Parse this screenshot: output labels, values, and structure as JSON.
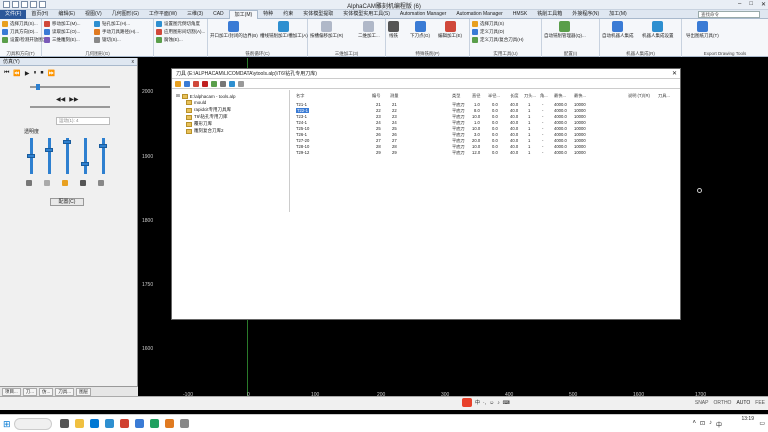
{
  "app": {
    "title": "AlphaCAM雕刻机编程版 (6)",
    "search_placeholder": "查找命令"
  },
  "tabs": [
    "文件(F)",
    "首页(H)",
    "编辑(E)",
    "视图(V)",
    "几何图形(G)",
    "工作平面(W)",
    "三维(3)",
    "CAD",
    "加工(M)",
    "特种",
    "约束",
    "实体模型提取",
    "实体模型实用工具(S)",
    "Automation Manager",
    "Automation Manager",
    "HMSK",
    "铣削工具箱",
    "外接程序(N)",
    "加工(M)"
  ],
  "ribbon": {
    "group1": {
      "label": "刀具和方向(T)",
      "items": [
        "选择刀具(S)...",
        "刀具方向(D)...",
        "设置/检测开放图元"
      ]
    },
    "group2": {
      "label": "几何图形(G)",
      "items": [
        "移动加工(M)...",
        "读取加工(O)...",
        "三维雕刻(E)...",
        "钻孔加工(H)...",
        "手动刀具路径(H)...",
        "锯切(S)..."
      ]
    },
    "group3": {
      "items": [
        "设置图元倒切角度",
        "应用图形间切割(A)...",
        "腐蚀(E)..."
      ]
    },
    "group4": {
      "label": "铣削循环(C)",
      "items": [
        "开口加工/封闭的边界(B)",
        "槽线铣削加工/槽加工(A)"
      ]
    },
    "group5": {
      "label": "三维加工(3)",
      "items": [
        "按槽偏移加工(R)",
        "二维加工..."
      ]
    },
    "group6": {
      "label": "特殊铣削(P)",
      "items": [
        "线铣",
        "下刀点(G)",
        "编辑加工(E)"
      ]
    },
    "group7": {
      "label": "实用工具(U)",
      "items": [
        "选择刀具(S)",
        "定义刀具(D)",
        "定义刀具/复合刀具(H)"
      ]
    },
    "group8": {
      "label": "配置(I)",
      "items": [
        "自动铣削管理器(Q)..."
      ]
    },
    "group9": {
      "label": "机器人集成(R)",
      "items": [
        "自动机器人集成",
        "机器人集成设置"
      ]
    },
    "group10": {
      "label": "Export Drawing Tools",
      "items": [
        "导出图纸刀具(T)"
      ]
    }
  },
  "left_panel": {
    "title": "仿真(Y)",
    "close": "x",
    "speed_label": "运动(1): 4",
    "visible_label": "透明度",
    "config_button": "配置(C)",
    "bottom_tabs": [
      "项目...",
      "刀...",
      "仿...",
      "刀具...",
      "图层"
    ]
  },
  "canvas": {
    "y_labels": [
      "2000",
      "1900",
      "1800",
      "1750",
      "1600"
    ],
    "x_labels": [
      "-100",
      "0",
      "100",
      "200",
      "300",
      "400",
      "500",
      "1600",
      "1700"
    ]
  },
  "dialog": {
    "title": "刀具 (E:\\ALPHACAM\\LICOMDATA\\ytools.alp)\\T6\\钻孔专用刀库)",
    "tree": {
      "root": "E:\\alphacam - tools.alp",
      "items": [
        "mould",
        "rapidcit专用刀具库",
        "T6\\钻孔专用刀库",
        "覆形刀库",
        "雕刻复合刀库2"
      ]
    },
    "columns": [
      "名字",
      "编号",
      "测量",
      "类型",
      "直径",
      "半径...",
      "长度",
      "刀头...",
      "角...",
      "最快...",
      "最快...",
      "说明 (T)/(R)",
      "刀具..."
    ],
    "rows": [
      [
        "T21-1",
        "21",
        "21",
        "平底刀",
        "1.0",
        "0.0",
        "40.0",
        "1",
        "-",
        "4000.0",
        "10000"
      ],
      [
        "T22-1",
        "22",
        "22",
        "平底刀",
        "8.0",
        "0.0",
        "40.0",
        "1",
        "-",
        "4000.0",
        "10000"
      ],
      [
        "T23-1",
        "23",
        "23",
        "平底刀",
        "10.0",
        "0.0",
        "40.0",
        "1",
        "-",
        "4000.0",
        "10000"
      ],
      [
        "T24-1",
        "24",
        "24",
        "平底刀",
        "1.0",
        "0.0",
        "40.0",
        "1",
        "-",
        "4000.0",
        "10000"
      ],
      [
        "T25-10",
        "25",
        "25",
        "平底刀",
        "10.0",
        "0.0",
        "40.0",
        "1",
        "-",
        "4000.0",
        "10000"
      ],
      [
        "T26-1",
        "26",
        "26",
        "平底刀",
        "3.0",
        "0.0",
        "40.0",
        "1",
        "-",
        "4000.0",
        "10000"
      ],
      [
        "T27-20",
        "27",
        "27",
        "平底刀",
        "20.0",
        "0.0",
        "40.0",
        "1",
        "-",
        "4000.0",
        "10000"
      ],
      [
        "T28-10",
        "28",
        "28",
        "平底刀",
        "10.0",
        "0.0",
        "40.0",
        "1",
        "-",
        "4000.0",
        "10000"
      ],
      [
        "T29-12",
        "29",
        "29",
        "平底刀",
        "12.0",
        "0.0",
        "40.0",
        "1",
        "-",
        "4000.0",
        "10000"
      ]
    ]
  },
  "statusbar": {
    "items": [
      "SNAP",
      "ORTHO",
      "AUTO",
      "FEE"
    ]
  },
  "taskbar": {
    "time": "13:19",
    "date": ""
  }
}
